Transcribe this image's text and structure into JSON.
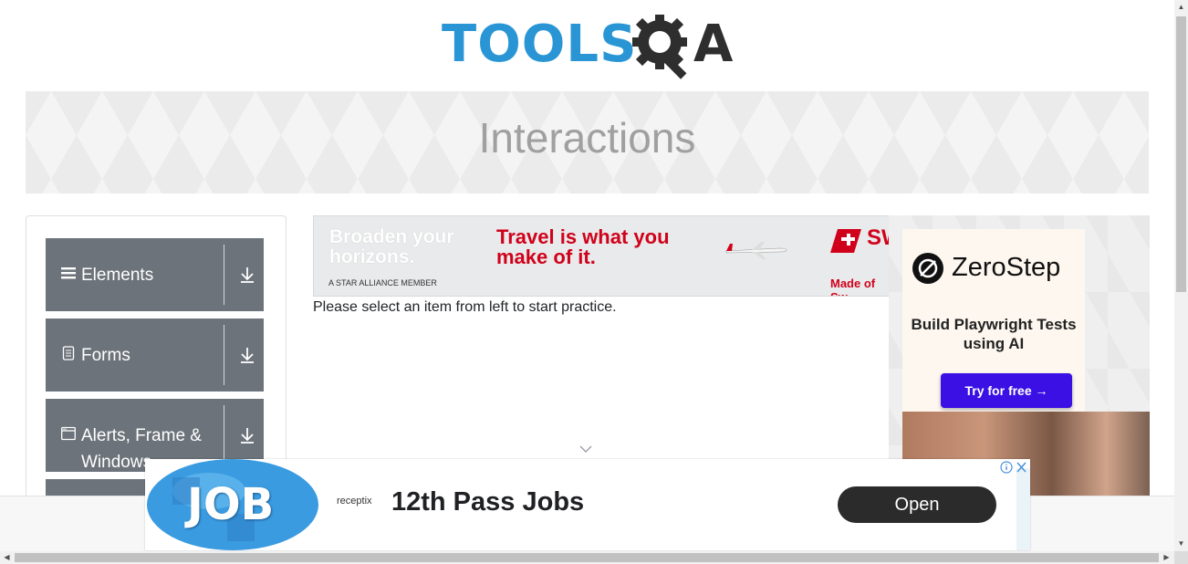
{
  "logo": {
    "text_tools": "TOOLS",
    "text_a": "A"
  },
  "banner": {
    "title": "Interactions"
  },
  "sidebar": {
    "groups": [
      {
        "label": "Elements",
        "icon": "hamburger-icon"
      },
      {
        "label": "Forms",
        "icon": "document-icon"
      },
      {
        "label": "Alerts, Frame & Windows",
        "icon": "window-icon"
      }
    ]
  },
  "ad_top": {
    "left_text": "Broaden your horizons.",
    "middle_text": "Travel is what you make of it.",
    "small_text": "A STAR ALLIANCE MEMBER",
    "brand_text": "SW",
    "footer_text": "Made of Sw"
  },
  "main": {
    "instructions": "Please select an item from left to start practice."
  },
  "right_ad": {
    "brand": "ZeroStep",
    "description": "Build Playwright Tests using AI",
    "button": "Try for free →"
  },
  "bottom_ad": {
    "image_text": "JOB",
    "brand": "receptix",
    "headline": "12th Pass Jobs",
    "button": "Open"
  },
  "colors": {
    "accent_blue": "#2a95d4",
    "sidebar_gray": "#6c737a",
    "cta_purple": "#3a10e5",
    "swiss_red": "#d0021b"
  }
}
